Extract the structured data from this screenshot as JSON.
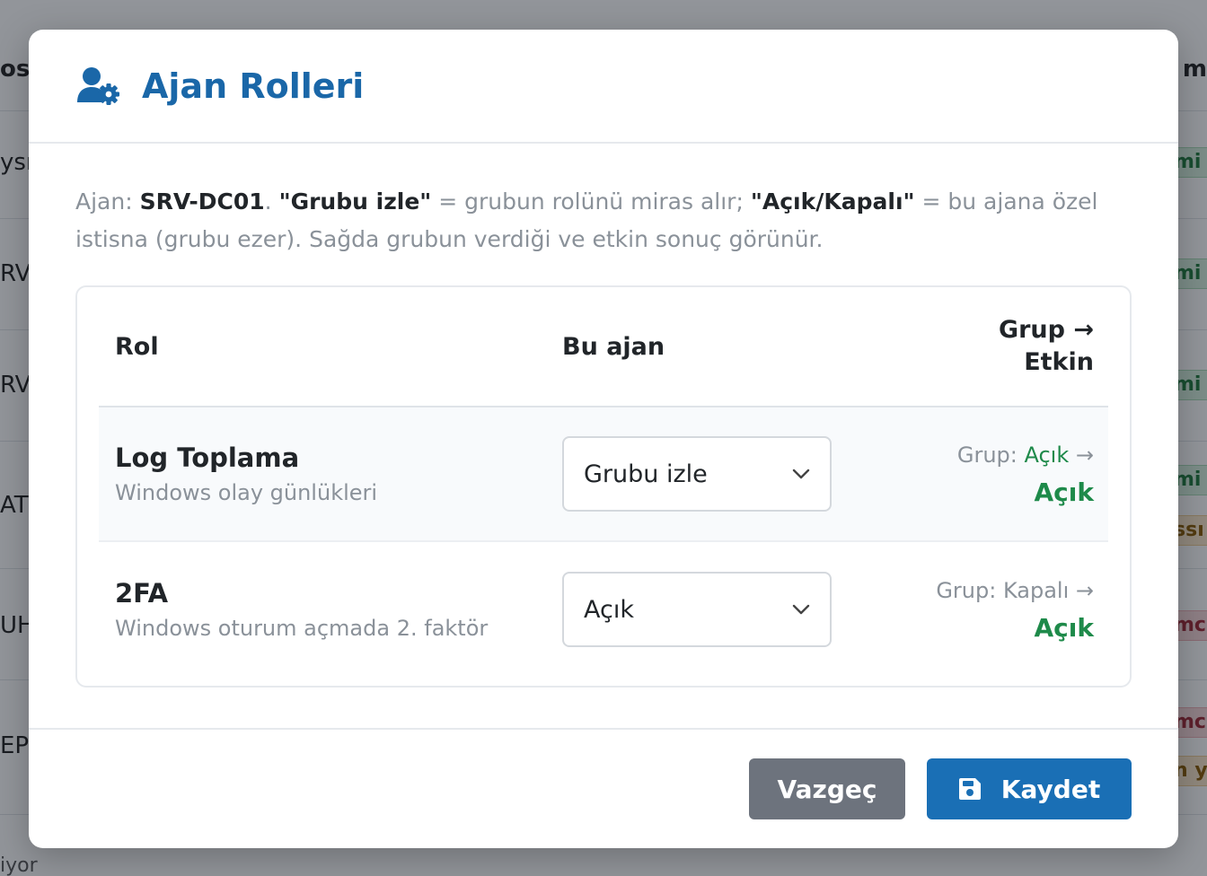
{
  "background": {
    "header_left": "os",
    "header_right": "m",
    "rows": [
      {
        "left": "ysn",
        "right": "mi",
        "status": "green"
      },
      {
        "left": "RV-",
        "right": "mi",
        "status": "green"
      },
      {
        "left": "RV-",
        "right": "mi",
        "status": "green"
      },
      {
        "left": "ATI",
        "right": "mi",
        "status": "green",
        "extra": "ssı",
        "extra_status": "orange"
      },
      {
        "left": "UH",
        "right": "mc",
        "status": "red"
      },
      {
        "left": "EPO",
        "right": "mc",
        "status": "red",
        "extra": "n y",
        "extra_status": "orange"
      }
    ],
    "bottom_text": "iyor"
  },
  "modal": {
    "title": "Ajan Rolleri",
    "title_icon": "user-gear-icon",
    "description": {
      "agent_label": "Ajan: ",
      "agent_name": "SRV-DC01",
      "sep": ". ",
      "follow_label": "\"Grubu izle\"",
      "follow_text": " = grubun rolünü miras alır; ",
      "override_label": "\"Açık/Kapalı\"",
      "override_text": " = bu ajana özel istisna (grubu ezer). Sağda grubun verdiği ve etkin sonuç görünür."
    },
    "table": {
      "headers": {
        "role": "Rol",
        "agent": "Bu ajan",
        "group_line1": "Grup →",
        "group_line2": "Etkin"
      },
      "rows": [
        {
          "name": "Log Toplama",
          "description": "Windows olay günlükleri",
          "selected": "Grubu izle",
          "group_label": "Grup: ",
          "group_value": "Açık",
          "arrow": " →",
          "effective": "Açık"
        },
        {
          "name": "2FA",
          "description": "Windows oturum açmada 2. faktör",
          "selected": "Açık",
          "group_label": "Grup: ",
          "group_value": "Kapalı",
          "arrow": " →",
          "effective": "Açık"
        }
      ]
    },
    "buttons": {
      "cancel": "Vazgeç",
      "save": "Kaydet",
      "save_icon": "floppy-disk-icon"
    }
  },
  "colors": {
    "accent": "#1a67a8",
    "primary_button": "#1a6fb5",
    "secondary_button": "#6d737d",
    "success": "#1e8a4a",
    "muted": "#8a9199"
  }
}
